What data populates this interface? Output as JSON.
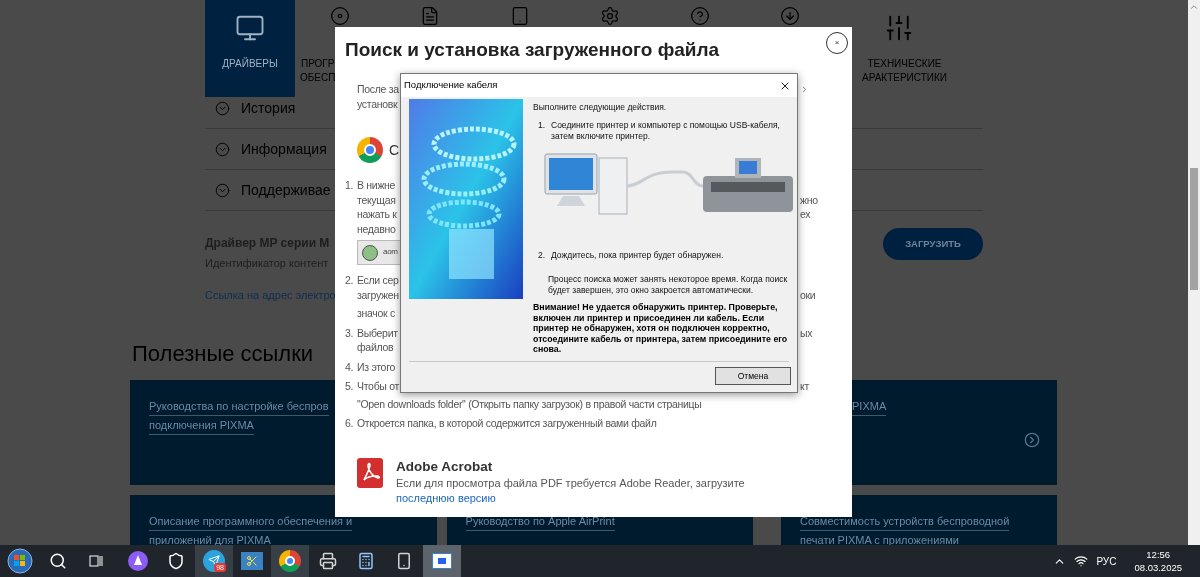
{
  "nav_tabs": [
    {
      "label_lines": [
        "ДРАЙВЕРЫ"
      ],
      "selected": true
    },
    {
      "label_lines": [
        "ПРОГР",
        "ОБЕСП"
      ],
      "selected": false
    },
    {
      "selected": false
    },
    {
      "selected": false
    },
    {
      "selected": false
    },
    {
      "selected": false
    },
    {
      "selected": false
    },
    {
      "label_lines": [
        "ТЕХНИЧЕСКИЕ",
        "АРАКТЕРИСТИКИ"
      ],
      "selected": false
    }
  ],
  "accordion": [
    {
      "label": "История",
      "expanded": false
    },
    {
      "label": "Информация",
      "expanded": false
    },
    {
      "label": "Поддерживае",
      "expanded": false
    }
  ],
  "driver": {
    "title": "Драйвер MP серии M",
    "content_id": "Идентификатор контент",
    "link": "Ссылка на адрес электро",
    "download_button": "ЗАГРУЗИТЬ"
  },
  "useful_links": {
    "heading": "Полезные ссылки",
    "cards": [
      {
        "lines": [
          "Руководства по настройке беспров",
          "подключения PIXMA"
        ],
        "wide": true
      },
      {
        "lines": [
          "PIXMA"
        ],
        "wide": false,
        "arrow": true,
        "indent": true
      },
      {
        "lines": [
          "Описание программного обеспечения и",
          "приложений для PIXMA"
        ],
        "wide": false
      },
      {
        "lines": [
          "Руководство по Apple AirPrint"
        ],
        "wide": false
      },
      {
        "lines": [
          "Совместимость устройств беспроводной",
          "печати PIXMA с приложениями"
        ],
        "wide": false
      }
    ]
  },
  "modal": {
    "title": "Поиск и установка загруженного файла",
    "close": "×",
    "intro": [
      {
        "text": "После за"
      },
      {
        "text": "установк"
      }
    ],
    "browser_fragment": "С",
    "steps": [
      {
        "number": "1.",
        "lines": [
          {
            "text": "В нижне"
          },
          {
            "text": "текущая",
            "tail": "жно"
          },
          {
            "text": "нажать к",
            "tail": "ех"
          },
          {
            "text": "недавно"
          }
        ],
        "chip": "aom"
      },
      {
        "number": "2.",
        "lines": [
          {
            "text": "Если сер"
          },
          {
            "text": "загружен",
            "tail": "оки"
          },
          {
            "text": "значок с"
          }
        ]
      },
      {
        "number": "3.",
        "lines": [
          {
            "text": "Выберит",
            "tail": "ых"
          },
          {
            "text": "файлов"
          }
        ]
      },
      {
        "number": "4.",
        "lines": [
          {
            "text": "Из этого"
          }
        ]
      },
      {
        "number": "5.",
        "lines": [
          {
            "text": "Чтобы от",
            "tail": "кт"
          },
          {
            "text": "\"Open downloads folder\" (Открыть папку загрузок) в правой части страницы"
          }
        ]
      },
      {
        "number": "6.",
        "lines": [
          {
            "text": "Откроется папка, в которой содержится загруженный вами файл"
          }
        ]
      }
    ],
    "acrobat": {
      "title": "Adobe Acrobat",
      "text": "Если для просмотра файла PDF требуется Adobe Reader, загрузите ",
      "link": "последнюю версию"
    }
  },
  "dialog": {
    "title": "Подключение кабеля",
    "lead": "Выполните следующие действия.",
    "steps": [
      {
        "number": "1.",
        "text": "Соедините принтер и компьютер с помощью USB-кабеля, затем включите принтер."
      },
      {
        "number": "2.",
        "text": "Дождитесь, пока принтер будет обнаружен."
      }
    ],
    "note": "Процесс поиска может занять некоторое время. Когда поиск будет завершен, это окно закроется автоматически.",
    "warning": "Внимание! Не удается обнаружить принтер. Проверьте, включен ли принтер и присоединен ли кабель. Если принтер не обнаружен, хотя он подключен корректно, отсоедините кабель от принтера, затем присоедините его снова.",
    "cancel_button": "Отмена"
  },
  "taskbar": {
    "apps": [
      {
        "open": false,
        "focused": false
      },
      {
        "open": false,
        "focused": false
      },
      {
        "open": false,
        "focused": false
      },
      {
        "open": false,
        "focused": false
      },
      {
        "open": false,
        "focused": false
      },
      {
        "open": true,
        "focused": false,
        "badge": "98"
      },
      {
        "open": false,
        "focused": false
      },
      {
        "open": true,
        "focused": false
      },
      {
        "open": false,
        "focused": false
      },
      {
        "open": false,
        "focused": false
      },
      {
        "open": false,
        "focused": false
      },
      {
        "open": true,
        "focused": true
      }
    ],
    "language": "РУС",
    "time": "12:56",
    "date": "08.03.2025"
  }
}
